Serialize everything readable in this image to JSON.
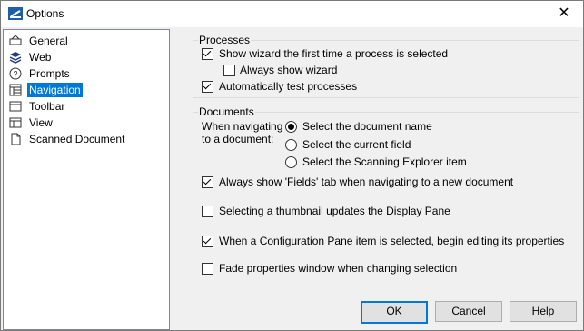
{
  "window": {
    "title": "Options",
    "close_glyph": "✕"
  },
  "tree": {
    "items": [
      {
        "label": "General",
        "icon": "general-icon"
      },
      {
        "label": "Web",
        "icon": "web-icon"
      },
      {
        "label": "Prompts",
        "icon": "prompts-icon"
      },
      {
        "label": "Navigation",
        "icon": "navigation-icon",
        "selected": true
      },
      {
        "label": "Toolbar",
        "icon": "toolbar-icon"
      },
      {
        "label": "View",
        "icon": "view-icon"
      },
      {
        "label": "Scanned Document",
        "icon": "scanned-document-icon"
      }
    ]
  },
  "processes": {
    "legend": "Processes",
    "show_wizard": {
      "label": "Show wizard the first time a process is selected",
      "checked": true
    },
    "always_show_wizard": {
      "label": "Always show wizard",
      "checked": false
    },
    "auto_test": {
      "label": "Automatically test processes",
      "checked": true
    }
  },
  "documents": {
    "legend": "Documents",
    "when_navigating_line1": "When navigating",
    "when_navigating_line2": "to a document:",
    "radio_options": [
      {
        "label": "Select the document name",
        "checked": true
      },
      {
        "label": "Select the current field",
        "checked": false
      },
      {
        "label": "Select the Scanning Explorer item",
        "checked": false
      }
    ],
    "always_show_fields": {
      "label": "Always show 'Fields' tab when navigating to a new document",
      "checked": true
    },
    "thumbnail_updates": {
      "label": "Selecting a thumbnail updates the Display Pane",
      "checked": false
    }
  },
  "config_pane_edit": {
    "label": "When a Configuration Pane item is selected, begin editing its properties",
    "checked": true
  },
  "fade_properties": {
    "label": "Fade properties window when changing selection",
    "checked": false
  },
  "buttons": {
    "ok": "OK",
    "cancel": "Cancel",
    "help": "Help"
  },
  "colors": {
    "selection": "#0078d7",
    "default_button_border": "#0078d7"
  }
}
